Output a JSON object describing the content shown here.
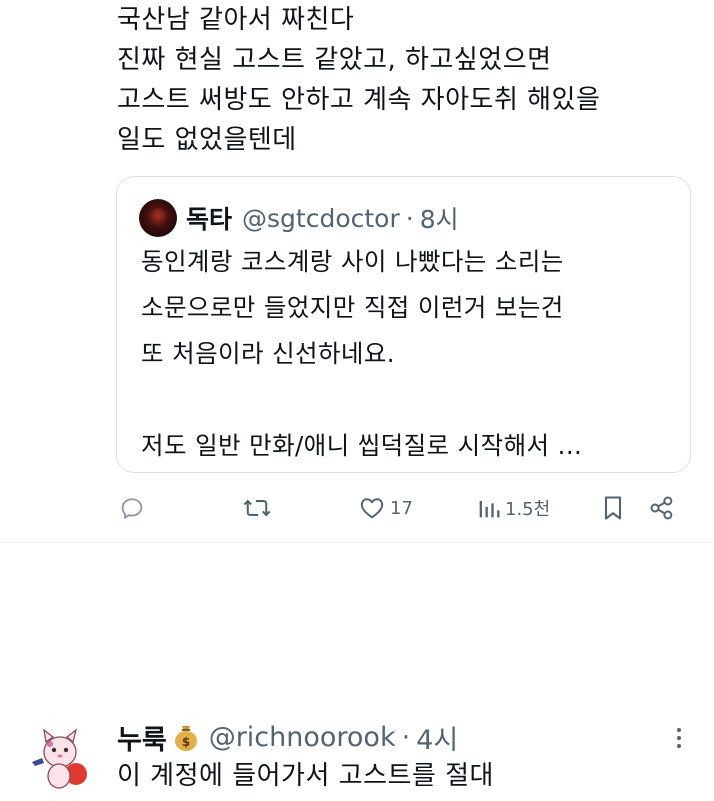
{
  "tweet": {
    "lines": [
      "국산남 같아서 짜친다",
      "진짜 현실 고스트 같았고, 하고싶었으면",
      "고스트 써방도 안하고 계속 자아도취 해있을",
      "일도 없었을텐데"
    ]
  },
  "quote": {
    "name": "독타",
    "handle": "@sgtcdoctor",
    "dot": "·",
    "time": "8시",
    "lines": [
      "동인계랑 코스계랑 사이 나빴다는 소리는",
      "소문으로만 들었지만 직접 이런거 보는건",
      "또 처음이라 신선하네요.",
      "",
      "저도 일반 만화/애니 씹덕질로 시작해서 ..."
    ]
  },
  "actions": {
    "reply_icon": "reply-icon",
    "retweet_icon": "retweet-icon",
    "like_icon": "heart-icon",
    "like_count": "17",
    "views_icon": "views-icon",
    "views_count": "1.5천",
    "bookmark_icon": "bookmark-icon",
    "share_icon": "share-icon"
  },
  "reply": {
    "name": "누룩",
    "name_emoji": "money-bag-icon",
    "handle": "@richnoorook",
    "dot": "·",
    "time": "4시",
    "text": "이 계정에 들어가서 고스트를 절대"
  },
  "colors": {
    "text": "#0f1419",
    "secondary": "#536471",
    "border": "#dfe3e7"
  }
}
